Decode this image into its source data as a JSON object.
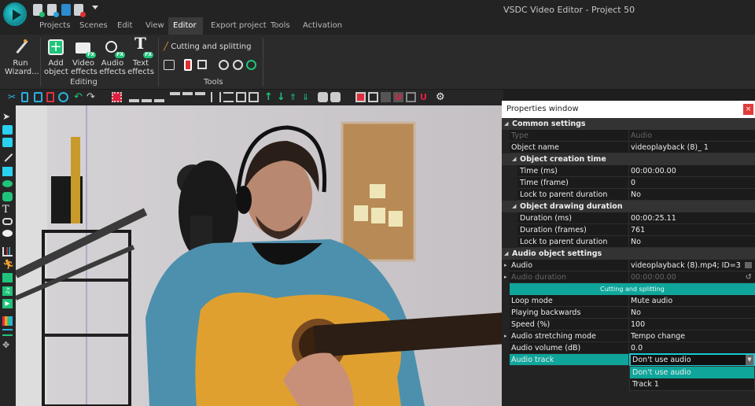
{
  "window": {
    "title": "VSDC Video Editor - Project 50"
  },
  "quick_access": [
    {
      "icon": "new-project-icon"
    },
    {
      "icon": "save-project-icon"
    },
    {
      "icon": "export-icon"
    },
    {
      "icon": "record-icon"
    },
    {
      "icon": "dropdown-icon"
    }
  ],
  "menu_tabs": [
    {
      "label": "Projects"
    },
    {
      "label": "Scenes"
    },
    {
      "label": "Edit"
    },
    {
      "label": "View"
    },
    {
      "label": "Editor",
      "active": true
    },
    {
      "label": "Export project"
    },
    {
      "label": "Tools"
    },
    {
      "label": "Activation"
    }
  ],
  "ribbon": {
    "run_wizard": {
      "line1": "Run",
      "line2": "Wizard..."
    },
    "editing": {
      "label": "Editing",
      "buttons": [
        {
          "line1": "Add",
          "line2": "object"
        },
        {
          "line1": "Video",
          "line2": "effects"
        },
        {
          "line1": "Audio",
          "line2": "effects"
        },
        {
          "line1": "Text",
          "line2": "effects"
        }
      ],
      "fx_badge": "FX"
    },
    "tools": {
      "label": "Tools",
      "cutting": "Cutting and splitting"
    }
  },
  "properties": {
    "title": "Properties window",
    "close": "×",
    "rows": [
      {
        "type": "section",
        "key": "Common settings"
      },
      {
        "type": "dim",
        "key": "Type",
        "value": "Audio"
      },
      {
        "type": "row",
        "key": "Object name",
        "value": "videoplayback (8)_ 1"
      },
      {
        "type": "subsection",
        "key": "Object creation time"
      },
      {
        "type": "subrow",
        "key": "Time (ms)",
        "value": "00:00:00.00"
      },
      {
        "type": "subrow",
        "key": "Time (frame)",
        "value": "0"
      },
      {
        "type": "subrow",
        "key": "Lock to parent duration",
        "value": "No"
      },
      {
        "type": "subsection",
        "key": "Object drawing duration"
      },
      {
        "type": "subrow",
        "key": "Duration (ms)",
        "value": "00:00:25.11"
      },
      {
        "type": "subrow",
        "key": "Duration (frames)",
        "value": "761"
      },
      {
        "type": "subrow",
        "key": "Lock to parent duration",
        "value": "No"
      },
      {
        "type": "section",
        "key": "Audio object settings"
      },
      {
        "type": "row",
        "key": "Audio",
        "value": "videoplayback (8).mp4; ID=3",
        "expander": true
      },
      {
        "type": "dim",
        "key": "Audio duration",
        "value": "00:00:00.00",
        "expander": true
      },
      {
        "type": "button",
        "key": "Cutting and splitting"
      },
      {
        "type": "row",
        "key": "Loop mode",
        "value": "Mute audio"
      },
      {
        "type": "row",
        "key": "Playing backwards",
        "value": "No"
      },
      {
        "type": "row",
        "key": "Speed (%)",
        "value": "100"
      },
      {
        "type": "row",
        "key": "Audio stretching mode",
        "value": "Tempo change",
        "expander": true
      },
      {
        "type": "row",
        "key": "Audio volume (dB)",
        "value": "0.0"
      },
      {
        "type": "selected",
        "key": "Audio track",
        "value": "Don't use audio"
      }
    ],
    "dropdown": {
      "selected": "Don't use audio",
      "options": [
        "Don't use audio",
        "Track 1"
      ]
    }
  },
  "colors": {
    "accent": "#0fa59a",
    "highlight": "#18c6d4",
    "close": "#e03b3b"
  }
}
